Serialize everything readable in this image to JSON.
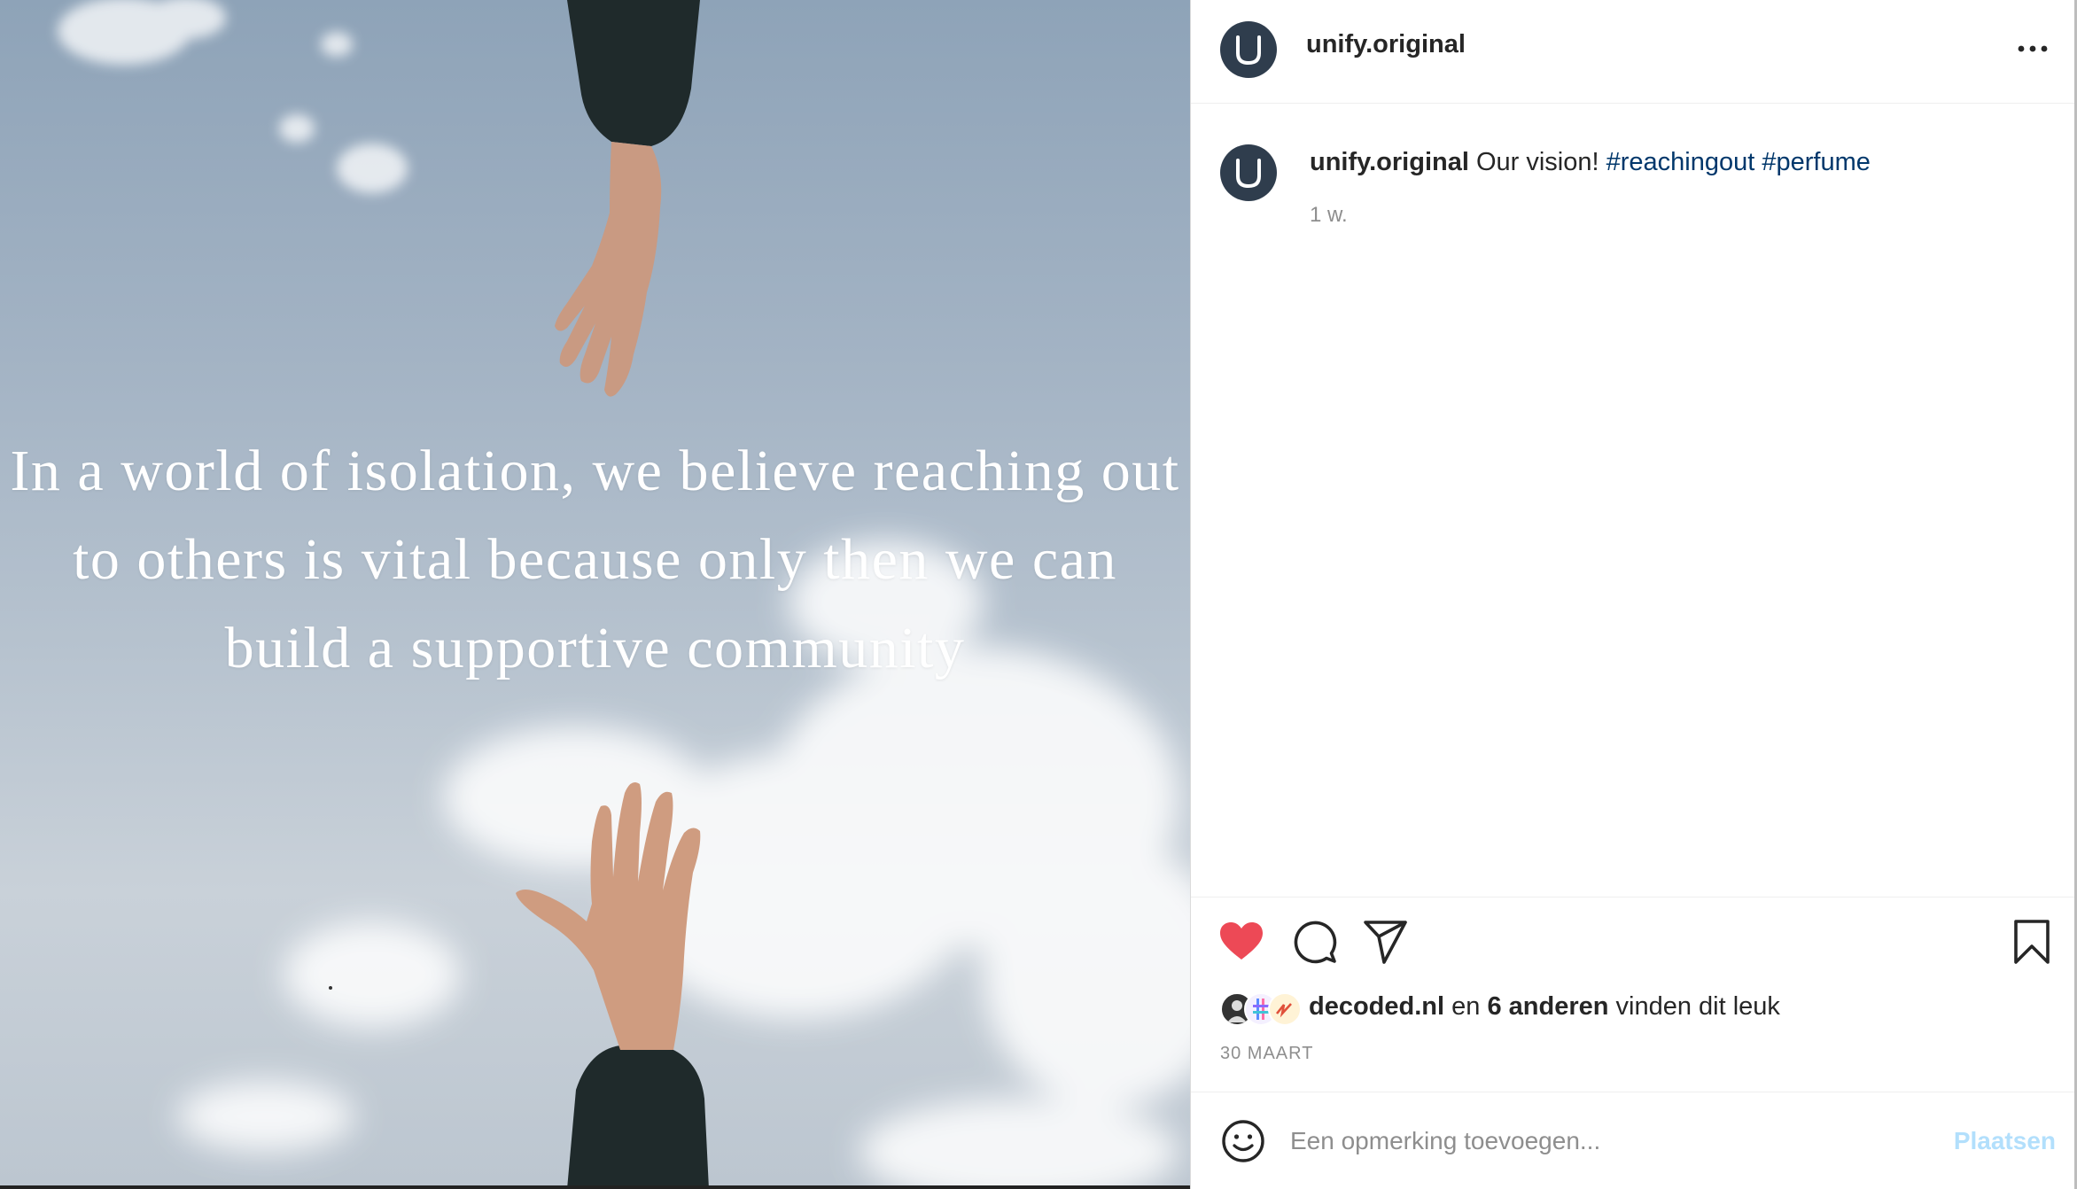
{
  "post": {
    "image_quote": {
      "line1": "In a world of isolation, we believe reaching out",
      "line2": "to others is vital because only then we can",
      "line3": "build a supportive community"
    }
  },
  "header": {
    "username": "unify.original",
    "avatar_icon": "unify-logo-icon",
    "more_icon": "more-options-icon"
  },
  "caption": {
    "username": "unify.original",
    "text": "Our vision!",
    "hashtags": [
      "#reachingout",
      "#perfume"
    ],
    "time_ago": "1 w."
  },
  "actions": {
    "like_icon": "heart-filled-icon",
    "comment_icon": "comment-icon",
    "share_icon": "paper-plane-icon",
    "save_icon": "bookmark-icon"
  },
  "likes": {
    "first_liker": "decoded.nl",
    "connector": "en",
    "others": "6 anderen",
    "suffix": "vinden dit leuk"
  },
  "post_date": "30 MAART",
  "comment_box": {
    "placeholder": "Een opmerking toevoegen...",
    "post_label": "Plaatsen",
    "emoji_icon": "emoji-icon"
  },
  "colors": {
    "like_red": "#ed4956",
    "hashtag_blue": "#00376b",
    "post_button_disabled": "#b2dffc",
    "text_primary": "#262626",
    "text_secondary": "#8e8e8e",
    "avatar_bg": "#2f3d4d"
  }
}
